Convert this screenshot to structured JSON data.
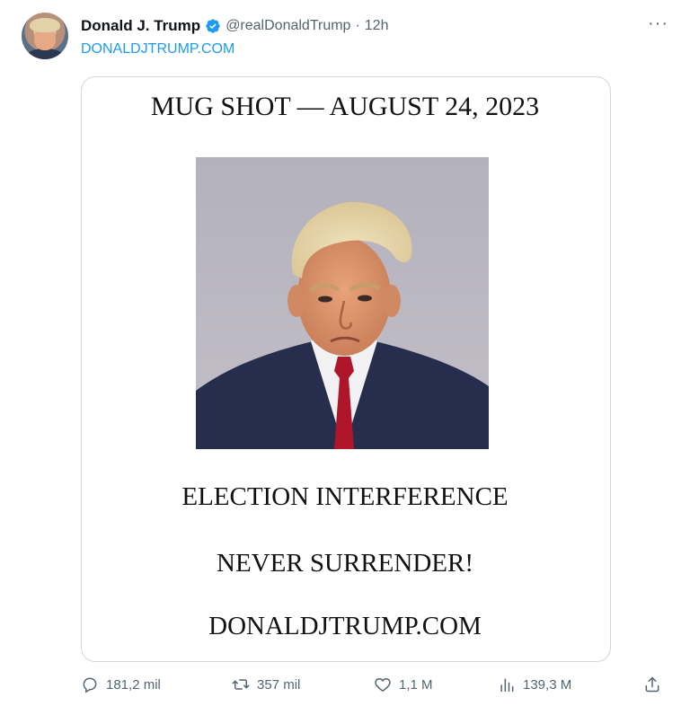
{
  "tweet": {
    "author_name": "Donald J. Trump",
    "handle": "@realDonaldTrump",
    "separator": "·",
    "time": "12h",
    "more_label": "···",
    "link_text": "DONALDJTRUMP.COM",
    "verified_color": "#1d9bf0"
  },
  "card": {
    "title": "MUG SHOT — AUGUST 24, 2023",
    "line1": "ELECTION INTERFERENCE",
    "line2": "NEVER SURRENDER!",
    "line3": "DONALDJTRUMP.COM"
  },
  "actions": {
    "replies": "181,2 mil",
    "retweets": "357 mil",
    "likes": "1,1 M",
    "views": "139,3 M"
  },
  "icons": [
    "verified-badge-icon",
    "more-icon",
    "reply-icon",
    "retweet-icon",
    "like-icon",
    "views-icon",
    "share-icon"
  ]
}
